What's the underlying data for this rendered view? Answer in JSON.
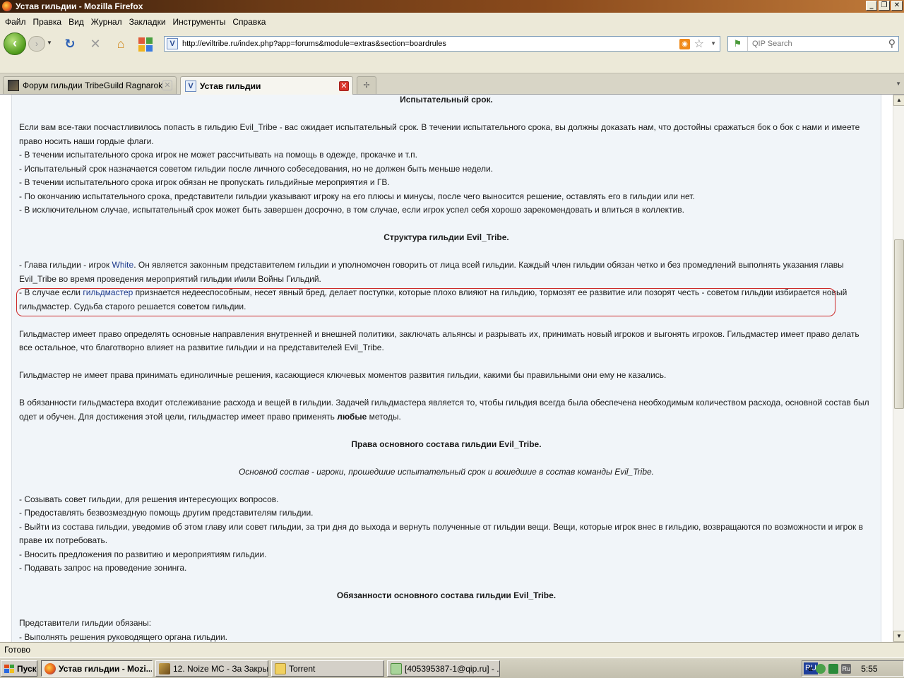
{
  "window": {
    "title": "Устав гильдии - Mozilla Firefox",
    "controls": [
      "_",
      "❐",
      "✕"
    ]
  },
  "menu": [
    "Файл",
    "Правка",
    "Вид",
    "Журнал",
    "Закладки",
    "Инструменты",
    "Справка"
  ],
  "nav": {
    "url": "http://eviltribe.ru/index.php?app=forums&module=extras&section=boardrules",
    "search_placeholder": "QIP Search",
    "favicon_glyph": "V"
  },
  "tabs": [
    {
      "label": "Форум гильдии TribeGuild Ragnarok O...",
      "active": false
    },
    {
      "label": "Устав гильдии",
      "active": true
    }
  ],
  "article": {
    "h_probation": "Испытательный срок.",
    "probation_intro": "Если вам все-таки посчастливилось попасть в гильдию Evil_Tribe - вас ожидает испытательный срок. В течении испытательного срока, вы должны доказать нам, что достойны сражаться бок о бок с нами и имеете право носить наши гордые флаги.",
    "probation_items": [
      "- В течении испытательного срока игрок не может рассчитывать на помощь в одежде, прокачке и т.п.",
      "- Испытательный срок назначается советом гильдии после личного собеседования, но не должен быть меньше недели.",
      "- В течении испытательного срока игрок обязан не пропускать гильдийные мероприятия и ГВ.",
      "- По окончанию испытательного срока, представители гильдии указывают игроку на его плюсы и минусы, после чего выносится решение, оставлять его в гильдии или нет.",
      "- В исключительном случае, испытательный срок может быть завершен досрочно, в том случае, если игрок успел себя хорошо зарекомендовать и влиться в коллектив."
    ],
    "h_structure": "Структура гильдии Evil_Tribe.",
    "leader_p1": "- Глава гильдии - игрок ",
    "leader_link": "White",
    "leader_p2": ". Он является законным представителем гильдии и уполномочен говорить от лица всей гильдии. Каждый член гильдии обязан четко и без промедлений выполнять указания главы Evil_Tribe во время проведения мероприятий гильдии и\\или Войны Гильдий.",
    "gm_p1": "- В случае если ",
    "gm_link": "гильдмастер",
    "gm_p2": " признается недееспособным, несет явный бред, делает поступки, которые плохо влияют на гильдию, тормозят ее развитие или позорят честь - советом гильдии избирается новый гильдмастер. Судьба старого решается советом гильдии.",
    "gm_rights": "Гильдмастер имеет право определять основные направления внутренней и внешней политики, заключать альянсы и разрывать их, принимать новый игроков и выгонять игроков. Гильдмастер имеет право делать все остальное, что благотворно влияет на развитие гильдии и на представителей Evil_Tribe.",
    "gm_limits": "Гильдмастер не имеет права принимать единоличные решения, касающиеся ключевых моментов развития гильдии, какими бы правильными они ему не казались.",
    "gm_duties_p1": "В обязанности гильдмастера входит отслеживание расхода и вещей в гильдии. Задачей гильдмастера является то, чтобы гильдия всегда была обеспечена необходимым количеством расхода, основной состав был одет и обучен. Для достижения этой цели, гильдмастер имеет право применять ",
    "gm_duties_bold": "любые",
    "gm_duties_p2": " методы.",
    "h_rights": "Права основного состава гильдии Evil_Tribe.",
    "core_def": "Основной состав - игроки, прошедшие испытательный срок и вошедшие в состав команды Evil_Tribe.",
    "rights_items": [
      "- Созывать совет гильдии, для решения интересующих вопросов.",
      "- Предоставлять безвозмездную помощь другим представителям гильдии.",
      "- Выйти из состава гильдии, уведомив об этом главу или совет гильдии, за три дня до выхода и вернуть полученные от гильдии вещи. Вещи, которые игрок внес в гильдию, возвращаются по возможности и игрок в праве их потребовать.",
      "- Вносить предложения по развитию и мероприятиям гильдии.",
      "- Подавать запрос на проведение зонинга."
    ],
    "h_duties": "Обязанности основного состава гильдии Evil_Tribe.",
    "duties_intro": "Представители гильдии обязаны:",
    "duties_first": "- Выполнять решения руководящего органа гильдии."
  },
  "status": "Готово",
  "taskbar": {
    "start": "Пуск",
    "tasks": [
      "Устав гильдии - Mozi...",
      "12. Noize MC - За Закры...",
      "Torrent",
      "[405395387-1@qip.ru] - ..."
    ],
    "lang": "RU",
    "tray_arrow": "«",
    "tray_label": "Ru",
    "clock": "5:55"
  }
}
